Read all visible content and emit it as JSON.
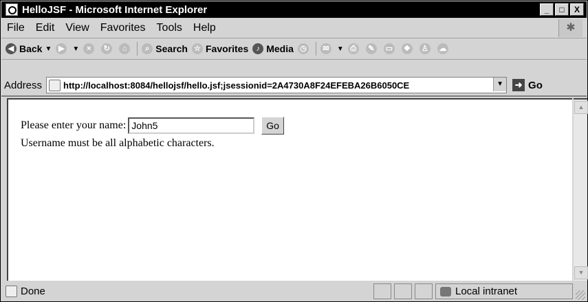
{
  "window": {
    "title": "HelloJSF - Microsoft Internet Explorer",
    "controls": [
      "_",
      "□",
      "X"
    ]
  },
  "menu": [
    "File",
    "Edit",
    "View",
    "Favorites",
    "Tools",
    "Help"
  ],
  "toolbar": {
    "back": "Back",
    "search": "Search",
    "favorites": "Favorites",
    "media": "Media"
  },
  "address": {
    "label": "Address",
    "url": "http://localhost:8084/hellojsf/hello.jsf;jsessionid=2A4730A8F24EFEBA26B6050CE",
    "go": "Go"
  },
  "form": {
    "prompt": "Please enter your name:",
    "name_value": "John5",
    "submit": "Go",
    "error": "Username must be all alphabetic characters."
  },
  "status": {
    "text": "Done",
    "zone": "Local intranet"
  }
}
